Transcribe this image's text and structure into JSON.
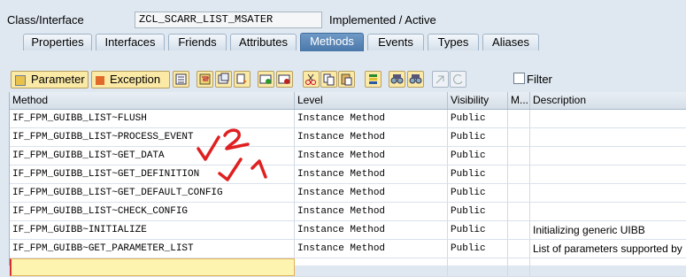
{
  "header": {
    "class_label": "Class/Interface",
    "class_value": "ZCL_SCARR_LIST_MSATER",
    "status": "Implemented / Active"
  },
  "tabs": [
    {
      "label": "Properties",
      "active": false
    },
    {
      "label": "Interfaces",
      "active": false
    },
    {
      "label": "Friends",
      "active": false
    },
    {
      "label": "Attributes",
      "active": false
    },
    {
      "label": "Methods",
      "active": true
    },
    {
      "label": "Events",
      "active": false
    },
    {
      "label": "Types",
      "active": false
    },
    {
      "label": "Aliases",
      "active": false
    }
  ],
  "toolbar": {
    "parameter_label": "Parameter",
    "exception_label": "Exception",
    "filter_label": "Filter",
    "filter_checked": false
  },
  "grid": {
    "columns": [
      "Method",
      "Level",
      "Visibility",
      "M...",
      "Description"
    ],
    "rows": [
      {
        "method": "IF_FPM_GUIBB_LIST~FLUSH",
        "level": "Instance Method",
        "visibility": "Public",
        "m": "",
        "description": ""
      },
      {
        "method": "IF_FPM_GUIBB_LIST~PROCESS_EVENT",
        "level": "Instance Method",
        "visibility": "Public",
        "m": "",
        "description": ""
      },
      {
        "method": "IF_FPM_GUIBB_LIST~GET_DATA",
        "level": "Instance Method",
        "visibility": "Public",
        "m": "",
        "description": ""
      },
      {
        "method": "IF_FPM_GUIBB_LIST~GET_DEFINITION",
        "level": "Instance Method",
        "visibility": "Public",
        "m": "",
        "description": ""
      },
      {
        "method": "IF_FPM_GUIBB_LIST~GET_DEFAULT_CONFIG",
        "level": "Instance Method",
        "visibility": "Public",
        "m": "",
        "description": ""
      },
      {
        "method": "IF_FPM_GUIBB_LIST~CHECK_CONFIG",
        "level": "Instance Method",
        "visibility": "Public",
        "m": "",
        "description": ""
      },
      {
        "method": "IF_FPM_GUIBB~INITIALIZE",
        "level": "Instance Method",
        "visibility": "Public",
        "m": "",
        "description": "Initializing generic UIBB"
      },
      {
        "method": "IF_FPM_GUIBB~GET_PARAMETER_LIST",
        "level": "Instance Method",
        "visibility": "Public",
        "m": "",
        "description": "List of parameters supported by"
      }
    ]
  },
  "annotations": {
    "mark_1": "✓ 2",
    "mark_2": "✓ 1",
    "color": "#e02020"
  }
}
